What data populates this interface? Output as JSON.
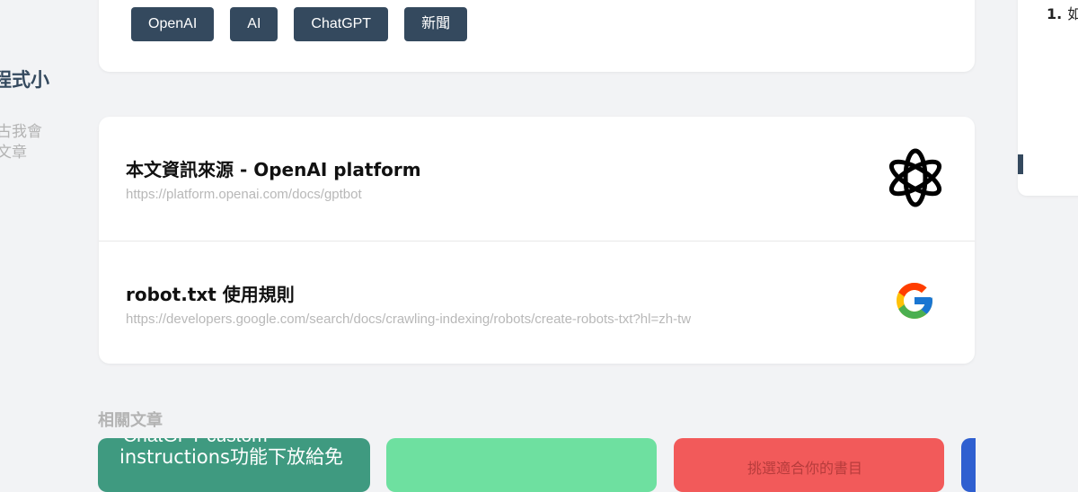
{
  "tags": [
    "OpenAI",
    "AI",
    "ChatGPT",
    "新聞"
  ],
  "left_sidebar": {
    "heading_fragment": "程式小",
    "desc_fragment": "古我會 文章"
  },
  "right_sidebar": {
    "list_number": "1.",
    "list_text_fragment": "如"
  },
  "sources": [
    {
      "title": "本文資訊來源 - OpenAI platform",
      "url": "https://platform.openai.com/docs/gptbot",
      "icon": "openai-logo-icon"
    },
    {
      "title": "robot.txt 使用規則",
      "url": "https://developers.google.com/search/docs/crawling-indexing/robots/create-robots-txt?hl=zh-tw",
      "icon": "google-logo-icon"
    }
  ],
  "related": {
    "heading": "相關文章",
    "cards": [
      {
        "title": "instructions功能下放給免",
        "top_fragment": "ChatGPT custom",
        "color": "#3f9a80"
      },
      {
        "title": "",
        "color": "#6ee0a0"
      },
      {
        "title": "挑選適合你的書目",
        "color": "#f25a5a"
      },
      {
        "title": "",
        "color": "#2f5fd0"
      }
    ]
  }
}
